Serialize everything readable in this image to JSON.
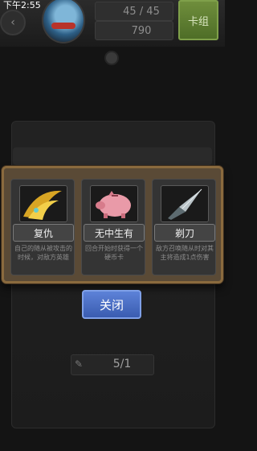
{
  "status_bar": {
    "time": "下午2:55"
  },
  "header": {
    "health": "45 / 45",
    "gold": "790",
    "deck_button": "卡组",
    "back_icon": "chevron-left-icon",
    "health_icon": "heart-gem-icon",
    "gold_icon": "coin-icon"
  },
  "modal": {
    "cards": [
      {
        "name": "复仇",
        "description": "自己的随从被攻击的时候，对敌方英雄",
        "art": "golden-claw"
      },
      {
        "name": "无中生有",
        "description": "回合开始时获得一个硬币卡",
        "art": "piggy-bank"
      },
      {
        "name": "剃刀",
        "description": "敌方召唤随从时对其主将造成1点伤害",
        "art": "razor-blade"
      }
    ],
    "close_button": "关闭"
  },
  "footer": {
    "counter": "5/1"
  }
}
